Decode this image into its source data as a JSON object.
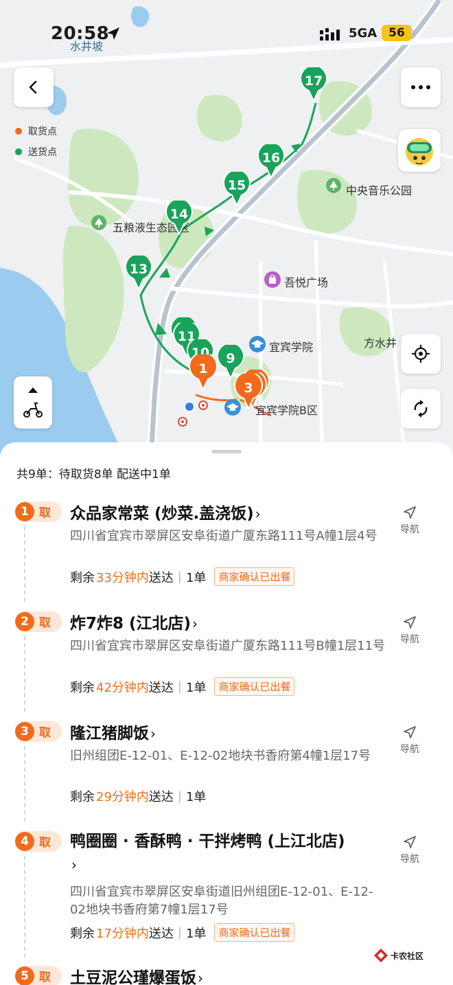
{
  "status": {
    "time": "20:58",
    "network": "5GA",
    "battery": "56"
  },
  "legend": {
    "pickup_label": "取货点",
    "delivery_label": "送货点",
    "pickup_color": "#f26b1d",
    "delivery_color": "#1aa35a"
  },
  "map": {
    "labels": {
      "shuijingpo": "水井坡",
      "wuliangye": "五粮液生态园区",
      "music_park": "中央音乐公园",
      "wuyue": "吾悦广场",
      "ybu": "宜宾学院",
      "fangshuijing": "方水井",
      "ybu_b": "宜宾学院B区"
    },
    "delivery_pins": [
      "17",
      "16",
      "15",
      "14",
      "13",
      "11",
      "10",
      "9"
    ],
    "pickup_pins": [
      "1",
      "3"
    ]
  },
  "summary": "共9单：待取货8单  配送中1单",
  "orders": [
    {
      "num": "1",
      "tag": "取",
      "name": "众品家常菜 (炒菜.盖浇饭)",
      "address": "四川省宜宾市翠屏区安阜街道广厦东路111号A幢1层4号",
      "remain_label": "剩余",
      "time": "33分钟内",
      "deliver_label": "送达",
      "count": "1单",
      "status": "商家确认已出餐",
      "nav": "导航"
    },
    {
      "num": "2",
      "tag": "取",
      "name": "炸7炸8 (江北店)",
      "address": "四川省宜宾市翠屏区安阜街道广厦东路111号B幢1层11号",
      "remain_label": "剩余",
      "time": "42分钟内",
      "deliver_label": "送达",
      "count": "1单",
      "status": "商家确认已出餐",
      "nav": "导航"
    },
    {
      "num": "3",
      "tag": "取",
      "name": "隆江猪脚饭",
      "address": "旧州组团E-12-01、E-12-02地块书香府第4幢1层17号",
      "remain_label": "剩余",
      "time": "29分钟内",
      "deliver_label": "送达",
      "count": "1单",
      "status": "",
      "nav": "导航"
    },
    {
      "num": "4",
      "tag": "取",
      "name": "鸭圈圈 · 香酥鸭 · 干拌烤鸭 (上江北店)",
      "address": "四川省宜宾市翠屏区安阜街道旧州组团E-12-01、E-12-02地块书香府第7幢1层17号",
      "remain_label": "剩余",
      "time": "17分钟内",
      "deliver_label": "送达",
      "count": "1单",
      "status": "商家确认已出餐",
      "nav": "导航"
    },
    {
      "num": "5",
      "tag": "取",
      "name": "土豆泥公瑾爆蛋饭",
      "nav": ""
    }
  ],
  "watermark": "卡农社区"
}
